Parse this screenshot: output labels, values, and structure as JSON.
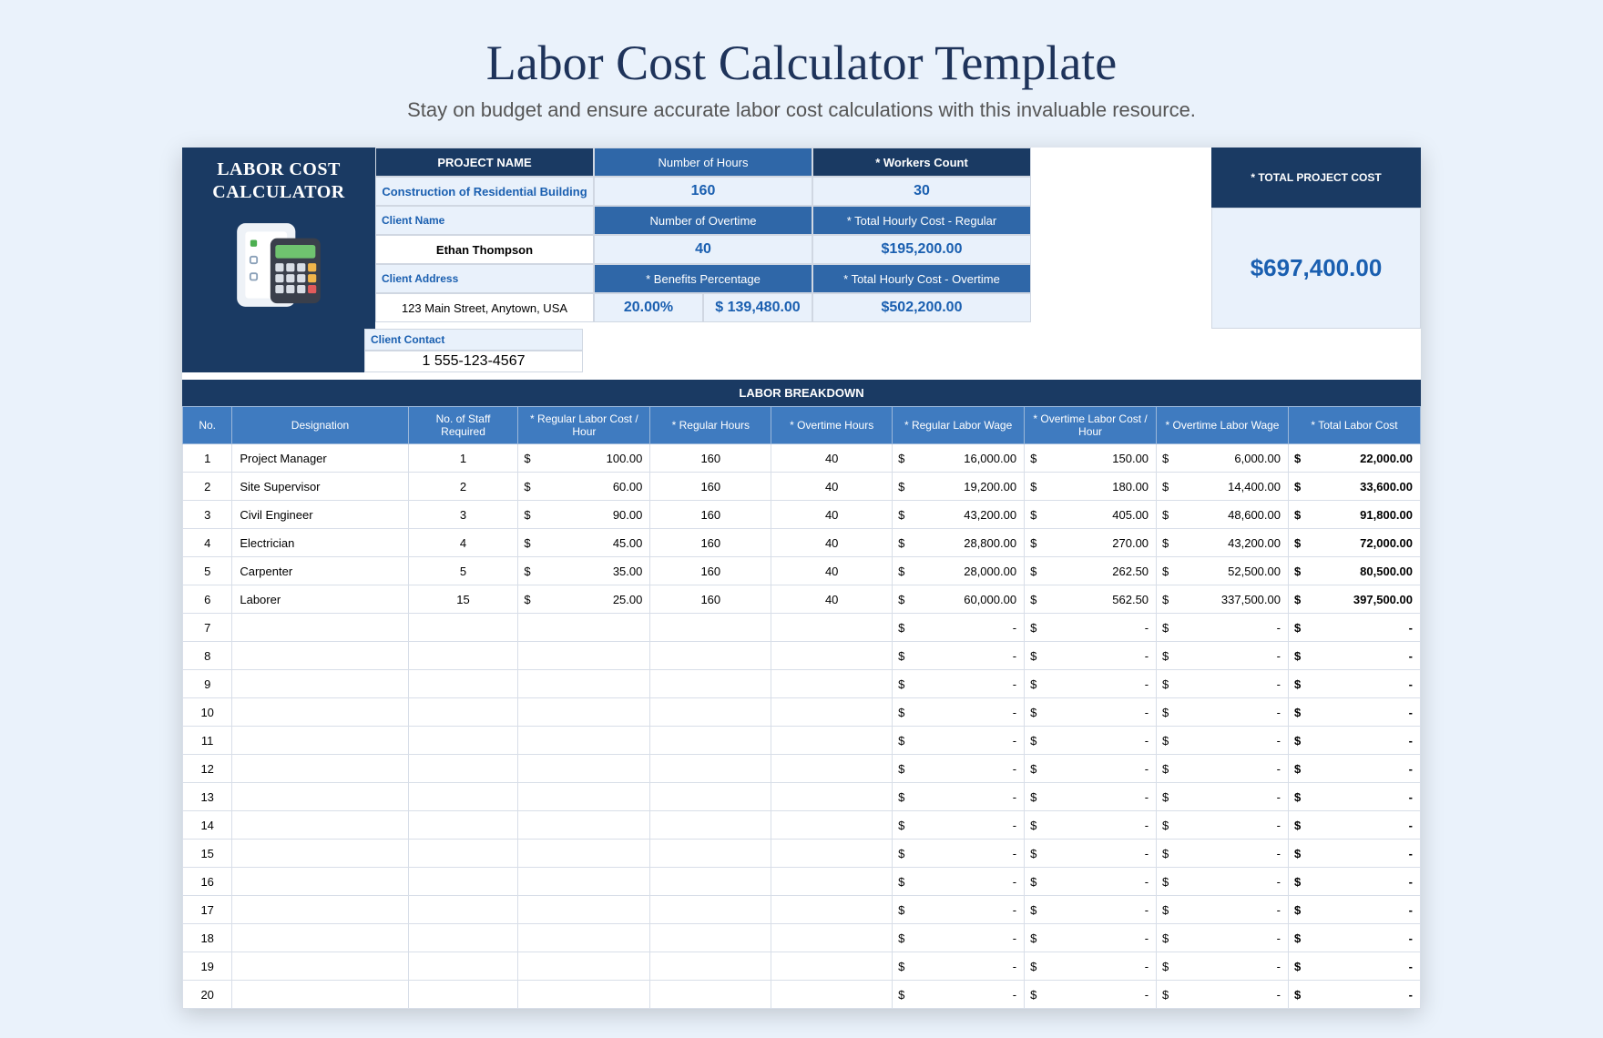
{
  "page": {
    "title": "Labor Cost Calculator Template",
    "subtitle": "Stay on budget and ensure accurate labor cost calculations with this invaluable resource."
  },
  "header": {
    "app_title_1": "LABOR COST",
    "app_title_2": "CALCULATOR",
    "project_name_label": "PROJECT NAME",
    "project_name": "Construction of Residential Building",
    "hours_label": "Number of Hours",
    "hours": "160",
    "workers_label": "* Workers Count",
    "workers": "30",
    "client_name_label": "Client Name",
    "client_name": "Ethan Thompson",
    "ot_label": "Number of Overtime",
    "ot": "40",
    "thc_reg_label": "* Total Hourly Cost - Regular",
    "thc_reg": "$195,200.00",
    "client_addr_label": "Client Address",
    "client_addr": "123 Main Street, Anytown, USA",
    "benefits_label": "* Benefits Percentage",
    "benefits_pct": "20.00%",
    "benefits_amt": "$ 139,480.00",
    "thc_ot_label": "* Total Hourly Cost - Overtime",
    "thc_ot": "$502,200.00",
    "client_contact_label": "Client Contact",
    "client_contact": "1 555-123-4567",
    "total_label": "* TOTAL PROJECT COST",
    "total": "$697,400.00"
  },
  "breakdown": {
    "title": "LABOR BREAKDOWN",
    "cols": [
      "No.",
      "Designation",
      "No. of Staff Required",
      "* Regular Labor Cost / Hour",
      "* Regular Hours",
      "* Overtime Hours",
      "* Regular Labor Wage",
      "* Overtime Labor Cost / Hour",
      "* Overtime Labor Wage",
      "* Total Labor Cost"
    ],
    "rows": [
      {
        "no": "1",
        "des": "Project Manager",
        "staff": "1",
        "regRate": "100.00",
        "regH": "160",
        "otH": "40",
        "regW": "16,000.00",
        "otRate": "150.00",
        "otW": "6,000.00",
        "total": "22,000.00"
      },
      {
        "no": "2",
        "des": "Site Supervisor",
        "staff": "2",
        "regRate": "60.00",
        "regH": "160",
        "otH": "40",
        "regW": "19,200.00",
        "otRate": "180.00",
        "otW": "14,400.00",
        "total": "33,600.00"
      },
      {
        "no": "3",
        "des": "Civil Engineer",
        "staff": "3",
        "regRate": "90.00",
        "regH": "160",
        "otH": "40",
        "regW": "43,200.00",
        "otRate": "405.00",
        "otW": "48,600.00",
        "total": "91,800.00"
      },
      {
        "no": "4",
        "des": "Electrician",
        "staff": "4",
        "regRate": "45.00",
        "regH": "160",
        "otH": "40",
        "regW": "28,800.00",
        "otRate": "270.00",
        "otW": "43,200.00",
        "total": "72,000.00"
      },
      {
        "no": "5",
        "des": "Carpenter",
        "staff": "5",
        "regRate": "35.00",
        "regH": "160",
        "otH": "40",
        "regW": "28,000.00",
        "otRate": "262.50",
        "otW": "52,500.00",
        "total": "80,500.00"
      },
      {
        "no": "6",
        "des": "Laborer",
        "staff": "15",
        "regRate": "25.00",
        "regH": "160",
        "otH": "40",
        "regW": "60,000.00",
        "otRate": "562.50",
        "otW": "337,500.00",
        "total": "397,500.00"
      },
      {
        "no": "7",
        "des": "",
        "staff": "",
        "regRate": "",
        "regH": "",
        "otH": "",
        "regW": "-",
        "otRate": "-",
        "otW": "-",
        "total": "-"
      },
      {
        "no": "8",
        "des": "",
        "staff": "",
        "regRate": "",
        "regH": "",
        "otH": "",
        "regW": "-",
        "otRate": "-",
        "otW": "-",
        "total": "-"
      },
      {
        "no": "9",
        "des": "",
        "staff": "",
        "regRate": "",
        "regH": "",
        "otH": "",
        "regW": "-",
        "otRate": "-",
        "otW": "-",
        "total": "-"
      },
      {
        "no": "10",
        "des": "",
        "staff": "",
        "regRate": "",
        "regH": "",
        "otH": "",
        "regW": "-",
        "otRate": "-",
        "otW": "-",
        "total": "-"
      },
      {
        "no": "11",
        "des": "",
        "staff": "",
        "regRate": "",
        "regH": "",
        "otH": "",
        "regW": "-",
        "otRate": "-",
        "otW": "-",
        "total": "-"
      },
      {
        "no": "12",
        "des": "",
        "staff": "",
        "regRate": "",
        "regH": "",
        "otH": "",
        "regW": "-",
        "otRate": "-",
        "otW": "-",
        "total": "-"
      },
      {
        "no": "13",
        "des": "",
        "staff": "",
        "regRate": "",
        "regH": "",
        "otH": "",
        "regW": "-",
        "otRate": "-",
        "otW": "-",
        "total": "-"
      },
      {
        "no": "14",
        "des": "",
        "staff": "",
        "regRate": "",
        "regH": "",
        "otH": "",
        "regW": "-",
        "otRate": "-",
        "otW": "-",
        "total": "-"
      },
      {
        "no": "15",
        "des": "",
        "staff": "",
        "regRate": "",
        "regH": "",
        "otH": "",
        "regW": "-",
        "otRate": "-",
        "otW": "-",
        "total": "-"
      },
      {
        "no": "16",
        "des": "",
        "staff": "",
        "regRate": "",
        "regH": "",
        "otH": "",
        "regW": "-",
        "otRate": "-",
        "otW": "-",
        "total": "-"
      },
      {
        "no": "17",
        "des": "",
        "staff": "",
        "regRate": "",
        "regH": "",
        "otH": "",
        "regW": "-",
        "otRate": "-",
        "otW": "-",
        "total": "-"
      },
      {
        "no": "18",
        "des": "",
        "staff": "",
        "regRate": "",
        "regH": "",
        "otH": "",
        "regW": "-",
        "otRate": "-",
        "otW": "-",
        "total": "-"
      },
      {
        "no": "19",
        "des": "",
        "staff": "",
        "regRate": "",
        "regH": "",
        "otH": "",
        "regW": "-",
        "otRate": "-",
        "otW": "-",
        "total": "-"
      },
      {
        "no": "20",
        "des": "",
        "staff": "",
        "regRate": "",
        "regH": "",
        "otH": "",
        "regW": "-",
        "otRate": "-",
        "otW": "-",
        "total": "-"
      }
    ]
  },
  "currency": "$"
}
